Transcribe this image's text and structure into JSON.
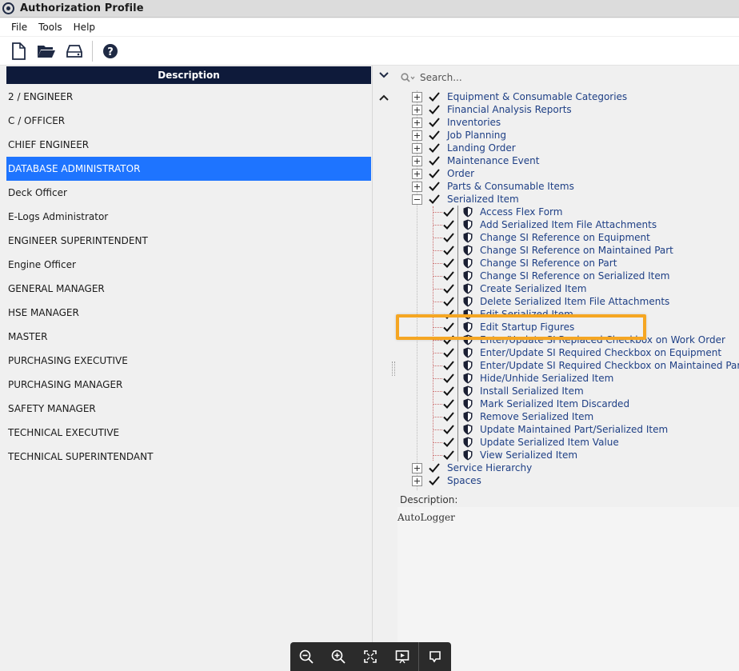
{
  "window": {
    "title": "Authorization Profile"
  },
  "menu": [
    "File",
    "Tools",
    "Help"
  ],
  "toolbar": {
    "icons": [
      "new-document-icon",
      "open-folder-icon",
      "drive-icon",
      "help-icon"
    ]
  },
  "left_panel": {
    "column_header": "Description",
    "selected_index": 3,
    "roles": [
      "2 / ENGINEER",
      "C / OFFICER",
      "CHIEF ENGINEER",
      "DATABASE ADMINISTRATOR",
      "Deck Officer",
      "E-Logs Administrator",
      "ENGINEER SUPERINTENDENT",
      "Engine Officer",
      "GENERAL MANAGER",
      "HSE MANAGER",
      "MASTER",
      "PURCHASING EXECUTIVE",
      "PURCHASING MANAGER",
      "SAFETY MANAGER",
      "TECHNICAL EXECUTIVE",
      "TECHNICAL SUPERINTENDANT"
    ]
  },
  "right_panel": {
    "search_placeholder": "Search...",
    "tree_top": [
      {
        "label": "Equipment & Consumable Categories",
        "expanded": false,
        "checked": true
      },
      {
        "label": "Financial Analysis Reports",
        "expanded": false,
        "checked": true
      },
      {
        "label": "Inventories",
        "expanded": false,
        "checked": true
      },
      {
        "label": "Job Planning",
        "expanded": false,
        "checked": true
      },
      {
        "label": "Landing Order",
        "expanded": false,
        "checked": true
      },
      {
        "label": "Maintenance Event",
        "expanded": false,
        "checked": true
      },
      {
        "label": "Order",
        "expanded": false,
        "checked": true
      },
      {
        "label": "Parts & Consumable Items",
        "expanded": false,
        "checked": true
      },
      {
        "label": "Serialized Item",
        "expanded": true,
        "checked": true
      }
    ],
    "serialized_item_children": [
      "Access Flex Form",
      "Add Serialized Item File Attachments",
      "Change SI Reference on Equipment",
      "Change SI Reference on Maintained Part",
      "Change SI Reference on Part",
      "Change SI Reference on Serialized Item",
      "Create Serialized Item",
      "Delete Serialized Item File Attachments",
      "Edit Serialized Item",
      "Edit Startup Figures",
      "Enter/Update SI Replaced Checkbox on Work Order",
      "Enter/Update SI Required Checkbox on Equipment",
      "Enter/Update SI Required Checkbox on Maintained Part",
      "Hide/Unhide Serialized Item",
      "Install Serialized Item",
      "Mark Serialized Item Discarded",
      "Remove Serialized Item",
      "Update Maintained Part/Serialized Item",
      "Update Serialized Item Value",
      "View Serialized Item"
    ],
    "tree_bottom": [
      {
        "label": "Service Hierarchy",
        "expanded": false,
        "checked": true
      },
      {
        "label": "Spaces",
        "expanded": false,
        "checked": true
      }
    ],
    "highlighted_item": "Edit Startup Figures",
    "description_label": "Description:",
    "description_value": "AutoLogger"
  },
  "zoom_toolbar": {
    "icons": [
      "zoom-out-icon",
      "zoom-in-icon",
      "fit-screen-icon",
      "present-icon",
      "comment-icon"
    ]
  },
  "colors": {
    "header": "#0e1a3a",
    "selection": "#1e74ff",
    "tree_text": "#1e3f85",
    "highlight": "#f5a623"
  }
}
